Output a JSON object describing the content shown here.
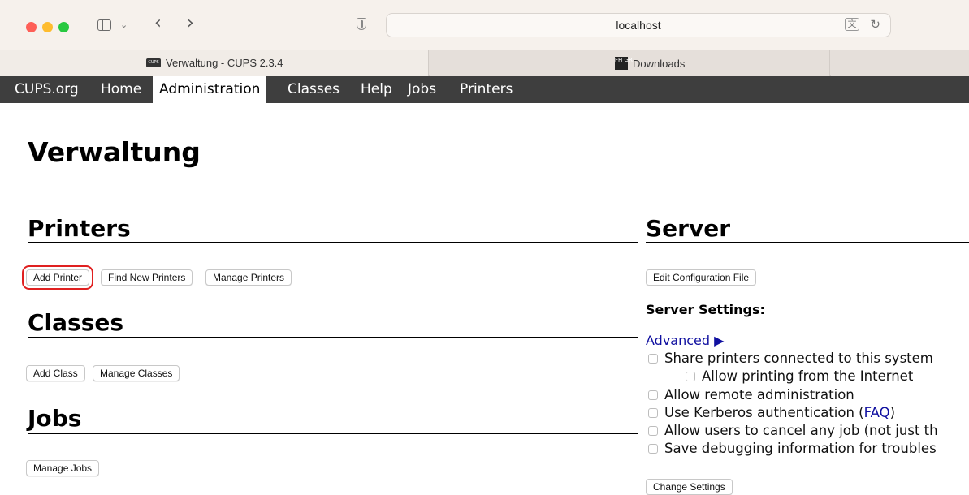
{
  "browser": {
    "url": "localhost",
    "tabs": [
      {
        "label": "Verwaltung - CUPS 2.3.4",
        "favicon": "CUPS",
        "active": true
      },
      {
        "label": "Downloads",
        "favicon": "FH GR",
        "active": false
      }
    ]
  },
  "cups_nav": {
    "items": [
      {
        "label": "CUPS.org"
      },
      {
        "label": "Home"
      },
      {
        "label": "Administration",
        "active": true
      },
      {
        "label": "Classes"
      },
      {
        "label": "Help"
      },
      {
        "label": "Jobs"
      },
      {
        "label": "Printers"
      }
    ]
  },
  "page": {
    "title": "Verwaltung",
    "printers": {
      "heading": "Printers",
      "buttons": {
        "add": "Add Printer",
        "find": "Find New Printers",
        "manage": "Manage Printers"
      }
    },
    "classes": {
      "heading": "Classes",
      "buttons": {
        "add": "Add Class",
        "manage": "Manage Classes"
      }
    },
    "jobs": {
      "heading": "Jobs",
      "buttons": {
        "manage": "Manage Jobs"
      }
    },
    "server": {
      "heading": "Server",
      "edit_config": "Edit Configuration File",
      "settings_heading": "Server Settings:",
      "advanced": "Advanced ▶",
      "options": {
        "share": "Share printers connected to this system",
        "internet": "Allow printing from the Internet",
        "remote_admin": "Allow remote administration",
        "kerberos_prefix": "Use Kerberos authentication (",
        "kerberos_link": "FAQ",
        "kerberos_suffix": ")",
        "cancel_jobs": "Allow users to cancel any job (not just th",
        "debug": "Save debugging information for troubles"
      },
      "change_settings": "Change Settings"
    }
  },
  "colors": {
    "nav_bg": "#3e3e3e",
    "link": "#1010a0",
    "highlight": "#e02020"
  }
}
